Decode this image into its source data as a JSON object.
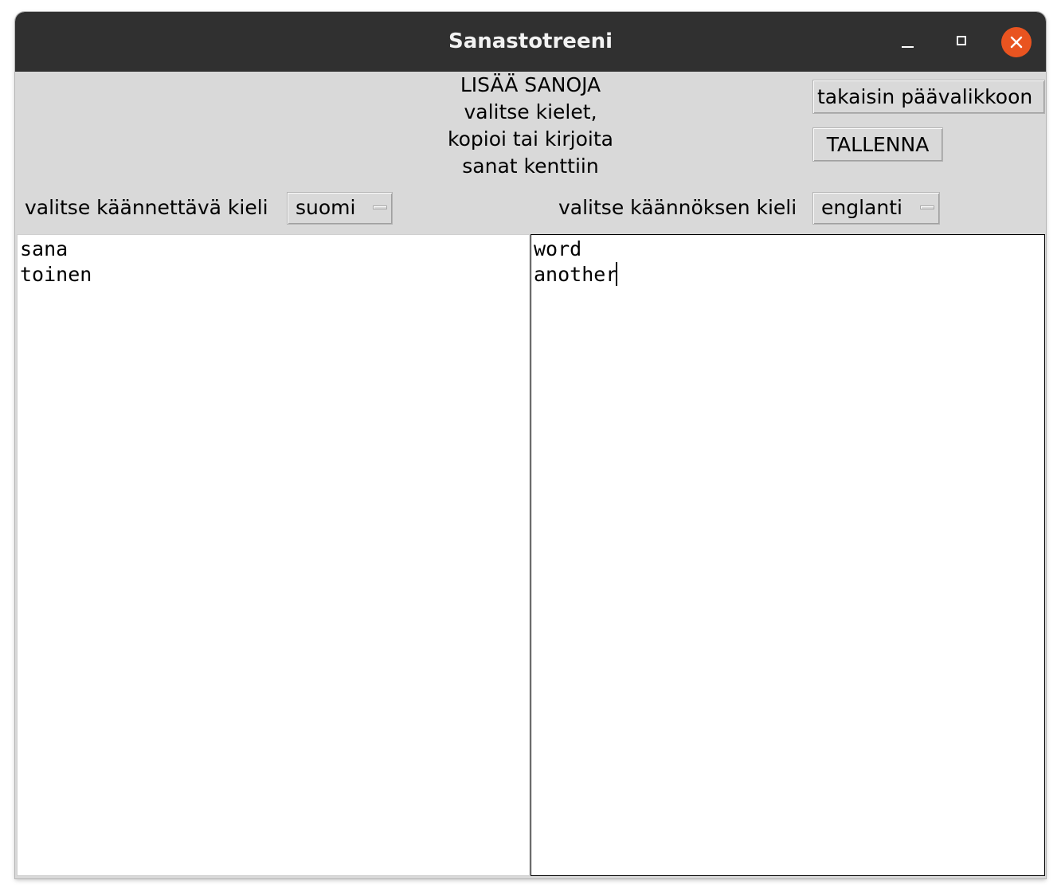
{
  "window": {
    "title": "Sanastotreeni",
    "controls": [
      "minimize-icon",
      "maximize-icon",
      "close-icon"
    ],
    "close_color": "#e95420"
  },
  "heading": {
    "lines": [
      "LISÄÄ SANOJA",
      "valitse kielet,",
      "kopioi tai kirjoita",
      "sanat kenttiin"
    ]
  },
  "buttons": {
    "back_label": "takaisin päävalikkoon",
    "save_label": "TALLENNA"
  },
  "source_language": {
    "label": "valitse käännettävä kieli",
    "selected": "suomi"
  },
  "target_language": {
    "label": "valitse käännöksen kieli",
    "selected": "englanti"
  },
  "source_words": {
    "lines": [
      "sana",
      "toinen"
    ]
  },
  "target_words": {
    "lines": [
      "word",
      "another"
    ]
  }
}
